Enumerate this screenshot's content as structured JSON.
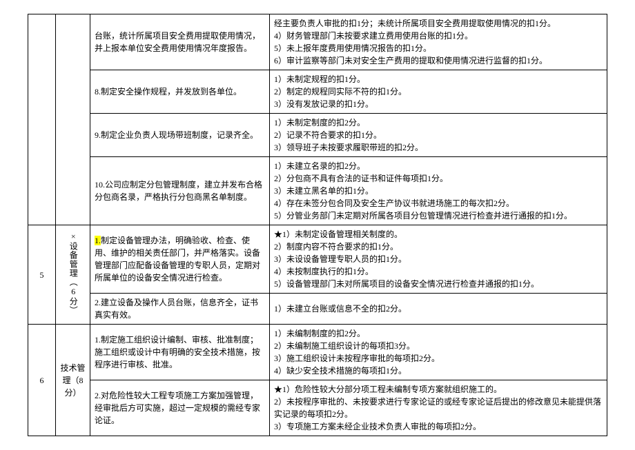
{
  "rows": [
    {
      "mid": "台账，统计所属项目安全费用提取使用情况，并上报本单位安全费用使用情况年度报告。",
      "right": "经主要负责人审批的扣1分；未统计所属项目安全费用提取使用情况的扣1分。\n4）财务管理部门未按要求建立费用使用台账的扣1分。\n5）未上报年度费用使用情况报告的扣1分。\n6）审计监察等部门未对安全生产费用的提取和使用情况进行监督的扣1分。"
    },
    {
      "mid": "8.制定安全操作规程，并发放到各单位。",
      "right": "1）未制定规程的扣1分。\n2）制定的规程同实际不符的扣1分。\n3）没有发放记录的扣1分。"
    },
    {
      "mid": "9.制定企业负责人现场带班制度，记录齐全。",
      "right": "1）未制定制度的扣2分。\n2）记录不符合要求的扣1分。\n3）领导班子未按要求履职带班的扣2分。"
    },
    {
      "mid": "10.公司应制定分包管理制度，建立并发布合格分包商名录，严格执行分包商黑名单制度。",
      "right": "1）未建立名录的扣2分。\n2）分包商不具有合法的证书和证件每项扣1分。\n3）未建立黑名单的扣1分。\n4）存在未签分包合同及安全生产协议书就进场施工的每次扣2分。\n5）分管业务部门未定期对所属各项目分包管理情况进行检查并进行通报的扣1分。"
    },
    {
      "num": "5",
      "cat": "×设备管理（6分）",
      "mid_prefix": "1.",
      "mid": "制定设备管理办法，明确验收、检查、使用、维护的相关责任部门，并严格落实。设备管理部门应配备设备管理的专职人员，定期对所属单位的设备安全情况进行检查。",
      "right": "★1）未制定设备管理相关制度的。\n2）制度内容不符合要求的扣1分。\n3）未设设备管理专职人员的扣1分。\n4）未按制度执行的扣1分。\n5）设备管理部门未对所属项目的设备安全情况进行检查并通报的扣1分。"
    },
    {
      "mid": "2.建立设备及操作人员台账，信息齐全，证书真实有效。",
      "right": "1）未建立台账或信息不全的扣2分。"
    },
    {
      "num": "6",
      "cat": "技术管理（8分）",
      "mid": "1.制定施工组织设计编制、审核、批准制度；施工组织或设计中有明确的安全技术措施，按程序进行审核、批准。",
      "right": "1）未编制制度的扣2分。\n2）未编制施工组织设计的每项扣3分。\n3）施工组织设计未按程序审批的每项扣2分。\n4）缺少安全技术措施的每项扣1分。"
    },
    {
      "mid": "2.对危险性较大工程专项施工方案加强管理，经审批后方可实施，超过一定规模的需经专家论证。",
      "right": "★1）危险性较大分部分项工程未编制专项方案就组织施工的。\n2）未按程序审批的、未按要求进行专家论证的或经专家论证后提出的修改意见未能提供落实记录的每项扣2分。\n3）专项施工方案未经企业技术负责人审批的每项扣2分。"
    }
  ]
}
